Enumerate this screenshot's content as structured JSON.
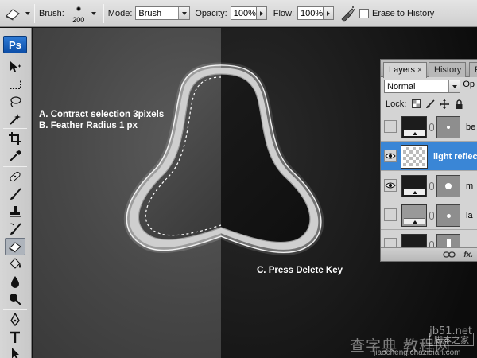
{
  "options_bar": {
    "brush_label": "Brush:",
    "brush_size": "200",
    "mode_label": "Mode:",
    "mode_value": "Brush",
    "opacity_label": "Opacity:",
    "opacity_value": "100%",
    "flow_label": "Flow:",
    "flow_value": "100%",
    "erase_to_history_label": "Erase to History",
    "erase_to_history_checked": false
  },
  "toolbox": {
    "logo": "Ps",
    "tools": [
      "move-icon",
      "marquee-icon",
      "lasso-icon",
      "magic-wand-icon",
      "crop-icon",
      "eyedropper-icon",
      "healing-brush-icon",
      "brush-icon",
      "clone-stamp-icon",
      "history-brush-icon",
      "eraser-icon",
      "paint-bucket-icon",
      "blur-icon",
      "dodge-icon",
      "pen-icon",
      "type-icon",
      "path-selection-icon"
    ],
    "active_tool": "eraser-icon"
  },
  "canvas": {
    "annotation_a": "A. Contract selection 3pixels",
    "annotation_b": "B. Feather Radius 1 px",
    "annotation_c": "C. Press Delete Key"
  },
  "layers_panel": {
    "tabs": [
      {
        "label": "Layers",
        "close": "×",
        "active": true
      },
      {
        "label": "History",
        "active": false
      },
      {
        "label": "P",
        "active": false
      }
    ],
    "blend_mode": "Normal",
    "opacity_cut": "Op",
    "lock_label": "Lock:",
    "layers": [
      {
        "name": "be",
        "visible": false,
        "selected": false
      },
      {
        "name": "light reflec",
        "visible": true,
        "selected": true
      },
      {
        "name": "m",
        "visible": true,
        "selected": false
      },
      {
        "name": "la",
        "visible": false,
        "selected": false
      },
      {
        "name": "",
        "visible": false,
        "selected": false
      }
    ],
    "footer_fx": "fx."
  },
  "watermark": {
    "site": "jb51.net",
    "chinese": "查字典 教程网",
    "url": "jiaocheng.chazidian.com",
    "box": "脚本之家"
  }
}
